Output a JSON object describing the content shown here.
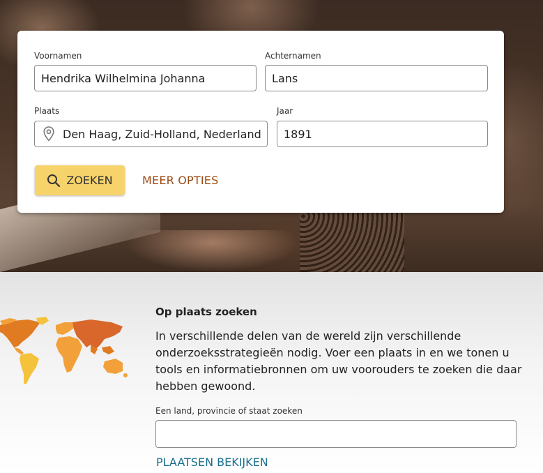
{
  "search_form": {
    "first_names_label": "Voornamen",
    "first_names_value": "Hendrika Wilhelmina Johanna",
    "last_names_label": "Achternamen",
    "last_names_value": "Lans",
    "place_label": "Plaats",
    "place_value": "Den Haag, Zuid-Holland, Nederland",
    "year_label": "Jaar",
    "year_value": "1891",
    "search_button": "ZOEKEN",
    "more_options": "MEER OPTIES"
  },
  "place_search": {
    "heading": "Op plaats zoeken",
    "description": "In verschillende delen van de wereld zijn verschillende onderzoeksstrategieën nodig. Voer een plaats in en we tonen u tools en informatiebronnen om uw voorouders te zoeken die daar hebben gewoond.",
    "input_label": "Een land, provincie of staat zoeken",
    "input_value": "",
    "view_places_link": "PLAATSEN BEKIJKEN"
  },
  "colors": {
    "search_button": "#f6d36b",
    "more_options_link": "#9c4a12",
    "view_places_link": "#1a6f8c",
    "map_colors": [
      "#e07b22",
      "#f2a13a",
      "#f5c23c",
      "#d9662a"
    ]
  },
  "icons": [
    "map-pin-icon",
    "search-icon",
    "world-map-icon"
  ]
}
